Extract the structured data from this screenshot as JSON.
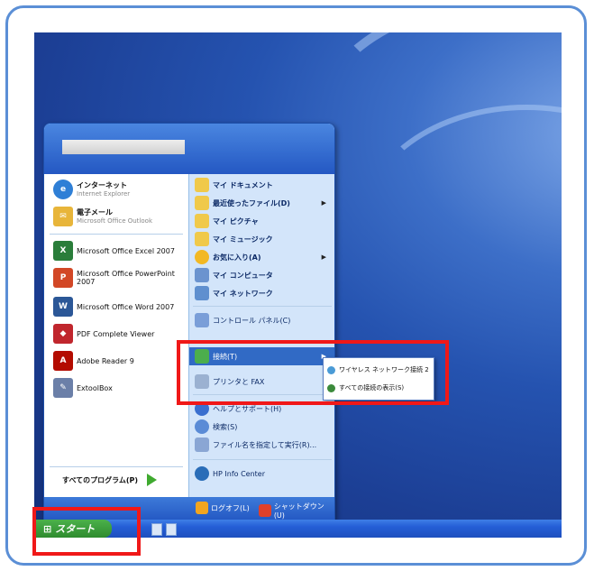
{
  "start_menu": {
    "user_name": "",
    "pinned": [
      {
        "name": "internet",
        "main": "インターネット",
        "sub": "Internet Explorer",
        "color": "#2f7fd6"
      },
      {
        "name": "email",
        "main": "電子メール",
        "sub": "Microsoft Office Outlook",
        "color": "#e8b53a"
      }
    ],
    "recent": [
      {
        "name": "excel",
        "label": "Microsoft Office Excel 2007",
        "color": "#2a7d3a"
      },
      {
        "name": "powerpoint",
        "label": "Microsoft Office PowerPoint 2007",
        "color": "#d24726"
      },
      {
        "name": "word",
        "label": "Microsoft Office Word 2007",
        "color": "#2b5797"
      },
      {
        "name": "pdf-viewer",
        "label": "PDF Complete Viewer",
        "color": "#c0262d"
      },
      {
        "name": "adobe-reader",
        "label": "Adobe Reader 9",
        "color": "#b30b00"
      },
      {
        "name": "extoolbox",
        "label": "ExtoolBox",
        "color": "#6b7fa8"
      }
    ],
    "all_programs": "すべてのプログラム(P)",
    "right_items": [
      {
        "name": "my-documents",
        "label": "マイ ドキュメント",
        "arrow": false,
        "color": "#f0c94a"
      },
      {
        "name": "recent-files",
        "label": "最近使ったファイル(D)",
        "arrow": true,
        "color": "#f0c94a"
      },
      {
        "name": "my-pictures",
        "label": "マイ ピクチャ",
        "arrow": false,
        "color": "#f0c94a"
      },
      {
        "name": "my-music",
        "label": "マイ ミュージック",
        "arrow": false,
        "color": "#f0c94a"
      },
      {
        "name": "favorites",
        "label": "お気に入り(A)",
        "arrow": true,
        "color": "#f2b824"
      },
      {
        "name": "my-computer",
        "label": "マイ コンピュータ",
        "arrow": false,
        "color": "#6b93cf"
      },
      {
        "name": "my-network",
        "label": "マイ ネットワーク",
        "arrow": false,
        "color": "#5f8fcf"
      }
    ],
    "control_panel": "コントロール パネル(C)",
    "connect": "接続(T)",
    "printers": "プリンタと FAX",
    "help": "ヘルプとサポート(H)",
    "search": "検索(S)",
    "run": "ファイル名を指定して実行(R)...",
    "hp_info": "HP Info Center",
    "logoff": "ログオフ(L)",
    "shutdown": "シャットダウン(U)"
  },
  "submenu": {
    "wireless": "ワイヤレス ネットワーク接続 2",
    "show_all": "すべての接続の表示(S)"
  },
  "taskbar": {
    "start_label": "スタート"
  },
  "colors": {
    "accent": "#2458c3",
    "highlight_box": "#f01818",
    "frame": "#5b8fd6"
  }
}
